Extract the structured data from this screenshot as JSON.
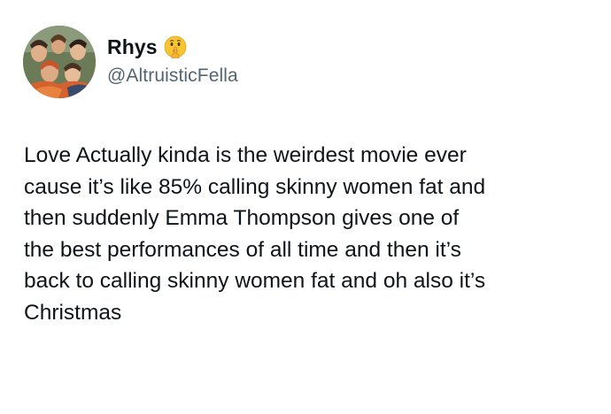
{
  "author": {
    "display_name": "Rhys",
    "name_emoji_icon": "shushing-face-emoji-icon",
    "handle": "@AltruisticFella",
    "avatar_icon": "group-photo-avatar"
  },
  "tweet": {
    "text": "Love Actually kinda is the weirdest movie ever\ncause it’s like 85% calling skinny women fat and\nthen suddenly Emma Thompson gives one of\nthe best performances of all time and then it’s\nback to calling skinny women fat and oh also it’s\nChristmas"
  },
  "colors": {
    "text_primary": "#0f1419",
    "text_secondary": "#536471",
    "background": "#ffffff"
  }
}
